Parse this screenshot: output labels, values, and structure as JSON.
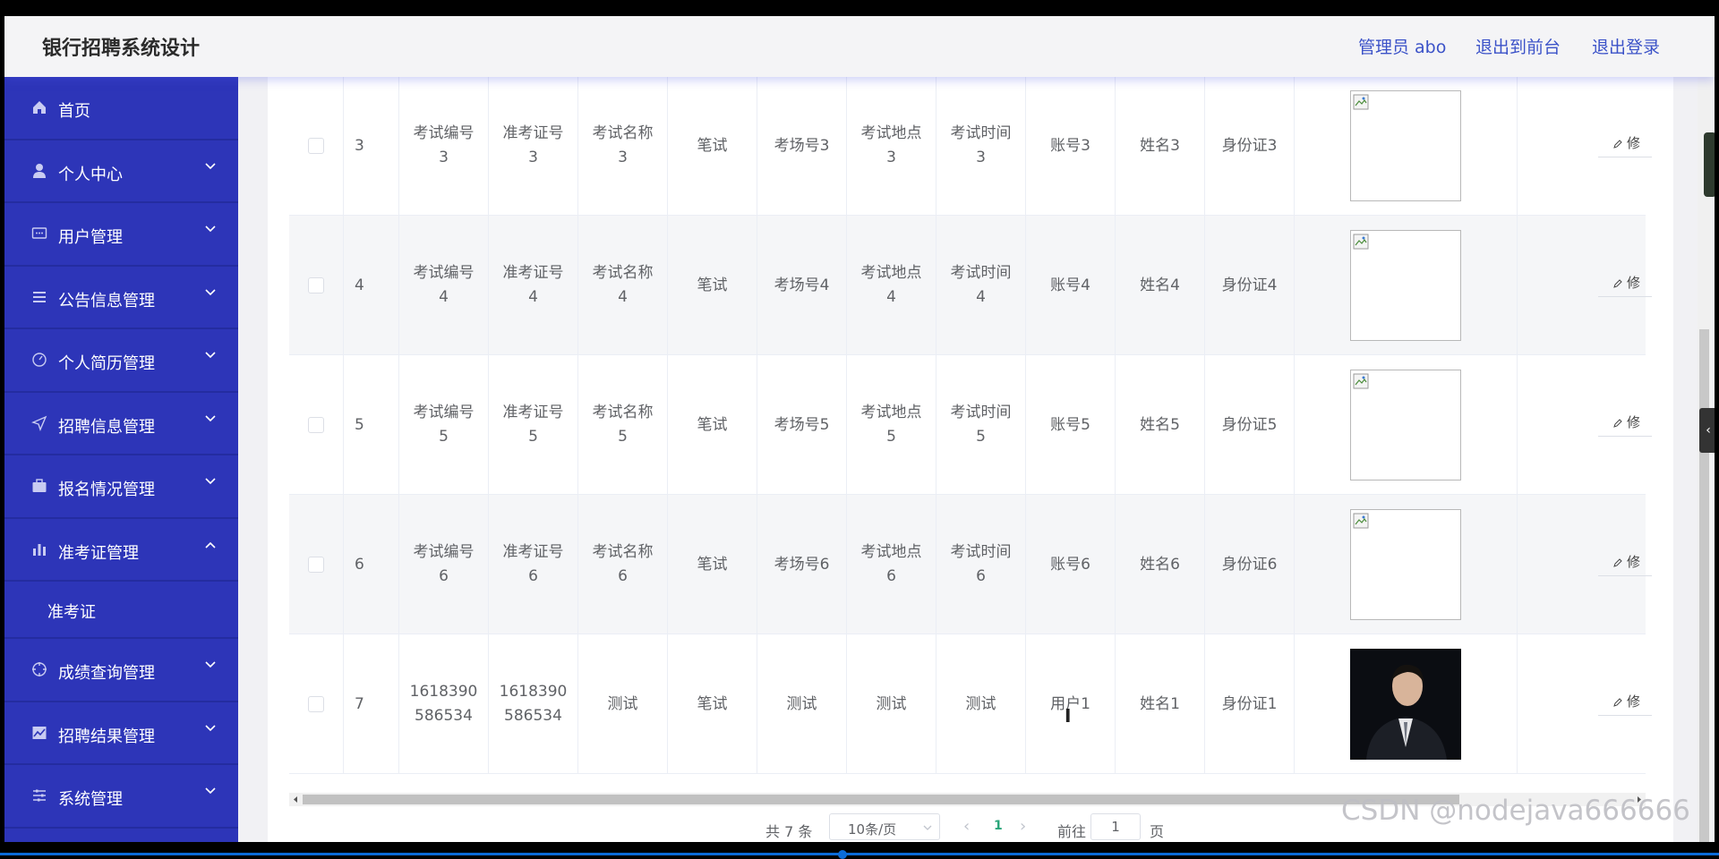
{
  "app": {
    "title": "银行招聘系统设计"
  },
  "header": {
    "admin": "管理员 abo",
    "to_front": "退出到前台",
    "logout": "退出登录"
  },
  "sidebar": {
    "items": [
      {
        "label": "首页",
        "icon": "home-icon"
      },
      {
        "label": "个人中心",
        "icon": "person-icon"
      },
      {
        "label": "用户管理",
        "icon": "chat-icon"
      },
      {
        "label": "公告信息管理",
        "icon": "list-icon"
      },
      {
        "label": "个人简历管理",
        "icon": "gauge-icon"
      },
      {
        "label": "招聘信息管理",
        "icon": "send-icon"
      },
      {
        "label": "报名情况管理",
        "icon": "briefcase-icon"
      },
      {
        "label": "准考证管理",
        "icon": "bar-chart-icon",
        "expanded": true
      },
      {
        "label": "成绩查询管理",
        "icon": "crosshair-icon"
      },
      {
        "label": "招聘结果管理",
        "icon": "chart-icon"
      },
      {
        "label": "系统管理",
        "icon": "sliders-icon"
      }
    ],
    "submenu": {
      "label": "准考证"
    }
  },
  "table": {
    "rows": [
      {
        "index": "3",
        "exam_no": "考试编号\n3",
        "ticket_no": "准考证号\n3",
        "exam_name": "考试名称\n3",
        "type": "笔试",
        "room": "考场号3",
        "place": "考试地点\n3",
        "time": "考试时间\n3",
        "account": "账号3",
        "name": "姓名3",
        "id_card": "身份证3",
        "photo": "broken-image-icon",
        "edit": "修"
      },
      {
        "index": "4",
        "exam_no": "考试编号\n4",
        "ticket_no": "准考证号\n4",
        "exam_name": "考试名称\n4",
        "type": "笔试",
        "room": "考场号4",
        "place": "考试地点\n4",
        "time": "考试时间\n4",
        "account": "账号4",
        "name": "姓名4",
        "id_card": "身份证4",
        "photo": "broken-image-icon",
        "edit": "修"
      },
      {
        "index": "5",
        "exam_no": "考试编号\n5",
        "ticket_no": "准考证号\n5",
        "exam_name": "考试名称\n5",
        "type": "笔试",
        "room": "考场号5",
        "place": "考试地点\n5",
        "time": "考试时间\n5",
        "account": "账号5",
        "name": "姓名5",
        "id_card": "身份证5",
        "photo": "broken-image-icon",
        "edit": "修"
      },
      {
        "index": "6",
        "exam_no": "考试编号\n6",
        "ticket_no": "准考证号\n6",
        "exam_name": "考试名称\n6",
        "type": "笔试",
        "room": "考场号6",
        "place": "考试地点\n6",
        "time": "考试时间\n6",
        "account": "账号6",
        "name": "姓名6",
        "id_card": "身份证6",
        "photo": "broken-image-icon",
        "edit": "修"
      },
      {
        "index": "7",
        "exam_no": "1618390\n586534",
        "ticket_no": "1618390\n586534",
        "exam_name": "测试",
        "type": "笔试",
        "room": "测试",
        "place": "测试",
        "time": "测试",
        "account": "用户1",
        "name": "姓名1",
        "id_card": "身份证1",
        "photo": "portrait-photo",
        "edit": "修"
      }
    ]
  },
  "pagination": {
    "total": "共 7 条",
    "page_size": "10条/页",
    "current": "1",
    "goto_label": "前往",
    "goto_value": "1",
    "page_unit": "页"
  },
  "watermark": "CSDN @nodejava666666"
}
